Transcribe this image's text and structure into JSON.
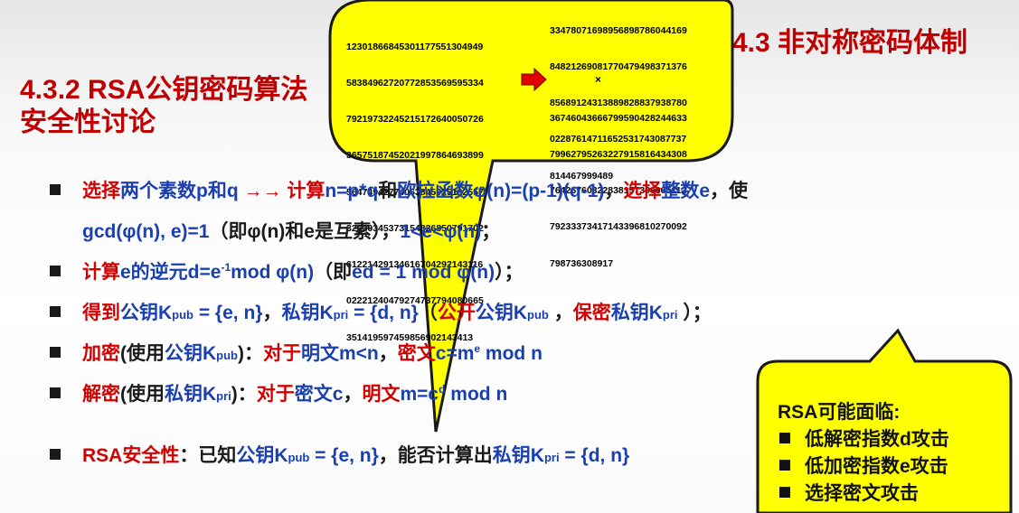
{
  "header": {
    "title": "4.3 非对称密码体制",
    "section": "4.3.2 RSA公钥密码算法",
    "section_sub": "安全性讨论"
  },
  "numbers": {
    "left_lines": [
      "12301866845301177551304949",
      "58384962720772853569595334",
      "79219732245215172640050726",
      "36575187452021997864693899",
      "56474942774063845925192557",
      "32630345373154826850791702",
      "61221429134616704292143116",
      "02221240479274737794080665",
      "35141959745985690214341​3"
    ],
    "right_top_lines": [
      "33478071698956898786044169",
      "84821269081770479498371376",
      "85689124313889828837938780",
      "02287614711652531743087737",
      "814467999489"
    ],
    "times": "×",
    "right_bottom_lines": [
      "36746043666799590428244633",
      "79962795263227915816434308",
      "76426760322838157396665112",
      "79233373417143396810270092",
      "798736308917"
    ]
  },
  "bullets": {
    "b1": {
      "r1": "选择",
      "b1": "两个素数p和q ",
      "r2": " →→ 计算",
      "b2": "n=p*q",
      "k1": "和",
      "b3": "欧拉函数φ(n)=(p-1)(q-1)",
      "k2": "，",
      "r3": "选择",
      "b4": "整数e",
      "k3": "，使"
    },
    "b1_cont": {
      "b1": "gcd(φ(n), e)=1",
      "k1": "（即φ(n)和e是互素），",
      "b2": "1<e<φ(n)",
      "k2": "；"
    },
    "b2": {
      "r1": "计算",
      "b1": "e的逆元d=e",
      "sup": "-1",
      "b2": "mod φ(n)",
      "k1": "（即",
      "b3": "ed = 1 mod φ(n)",
      "k2": "）；"
    },
    "b3": {
      "r1": "得到",
      "b1": "公钥K",
      "sub1": "pub",
      "b2": " = {e, n}",
      "k1": "，",
      "b3": "私钥K",
      "sub2": "pri",
      "b4": " = {d, n}",
      "k2": "（",
      "r2": "公开",
      "b5": "公钥K",
      "sub3": "pub",
      "k3": " ，",
      "r3": "保密",
      "b6": "私钥K",
      "sub4": "pri",
      "k4": " ）；"
    },
    "b4": {
      "r1": "加密",
      "k1": "(使用",
      "b1": "公钥K",
      "sub": "pub",
      "k2": ")：",
      "r2": "对于",
      "b2": "明文m<n",
      "k3": "，",
      "r3": "密文",
      "b3": "c=m",
      "sup": "e",
      "b4": " mod n"
    },
    "b5": {
      "r1": "解密",
      "k1": "(使用",
      "b1": "私钥K",
      "sub": "pri",
      "k2": ")：",
      "r2": "对于",
      "b2": "密文c",
      "k3": "，",
      "r3": "明文",
      "b3": "m=c",
      "sup": "d",
      "b4": " mod n"
    },
    "b6": {
      "r1": "RSA安全性",
      "k1": "：已知",
      "b1": "公钥K",
      "sub1": "pub",
      "b2": " = {e, n}",
      "k2": "，能否计算出",
      "b3": "私钥K",
      "sub2": "pri",
      "b4": " = {d, n}"
    }
  },
  "callout": {
    "title": "RSA可能面临:",
    "items": [
      "低解密指数d攻击",
      "低加密指数e攻击",
      "选择密文攻击"
    ]
  },
  "colors": {
    "accent_red": "#c00000",
    "text_blue": "#1a3fb0",
    "bubble_yellow": "#ffff00",
    "bubble_border": "#1a1a1a"
  }
}
